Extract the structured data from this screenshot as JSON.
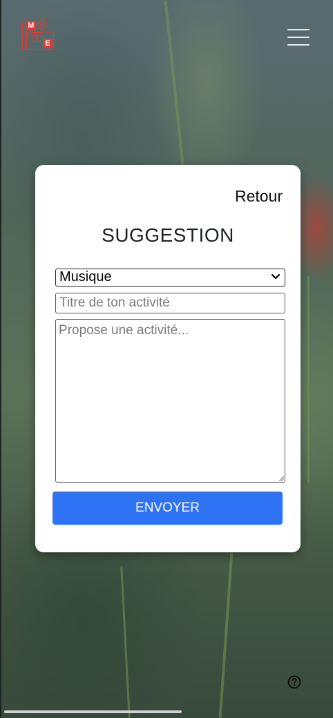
{
  "header": {
    "logo": {
      "letters": [
        "M",
        "O",
        "V",
        "E"
      ]
    },
    "menu_icon": "hamburger-icon"
  },
  "card": {
    "back_label": "Retour",
    "title": "SUGGESTION",
    "category_select": {
      "selected": "Musique"
    },
    "title_input": {
      "placeholder": "Titre de ton activité"
    },
    "description_input": {
      "placeholder": "Propose une activité..."
    },
    "submit_label": "ENVOYER"
  },
  "footer": {
    "help_icon": "question-circle-icon"
  },
  "colors": {
    "accent": "#2f73f5",
    "brand": "#e23a33"
  }
}
